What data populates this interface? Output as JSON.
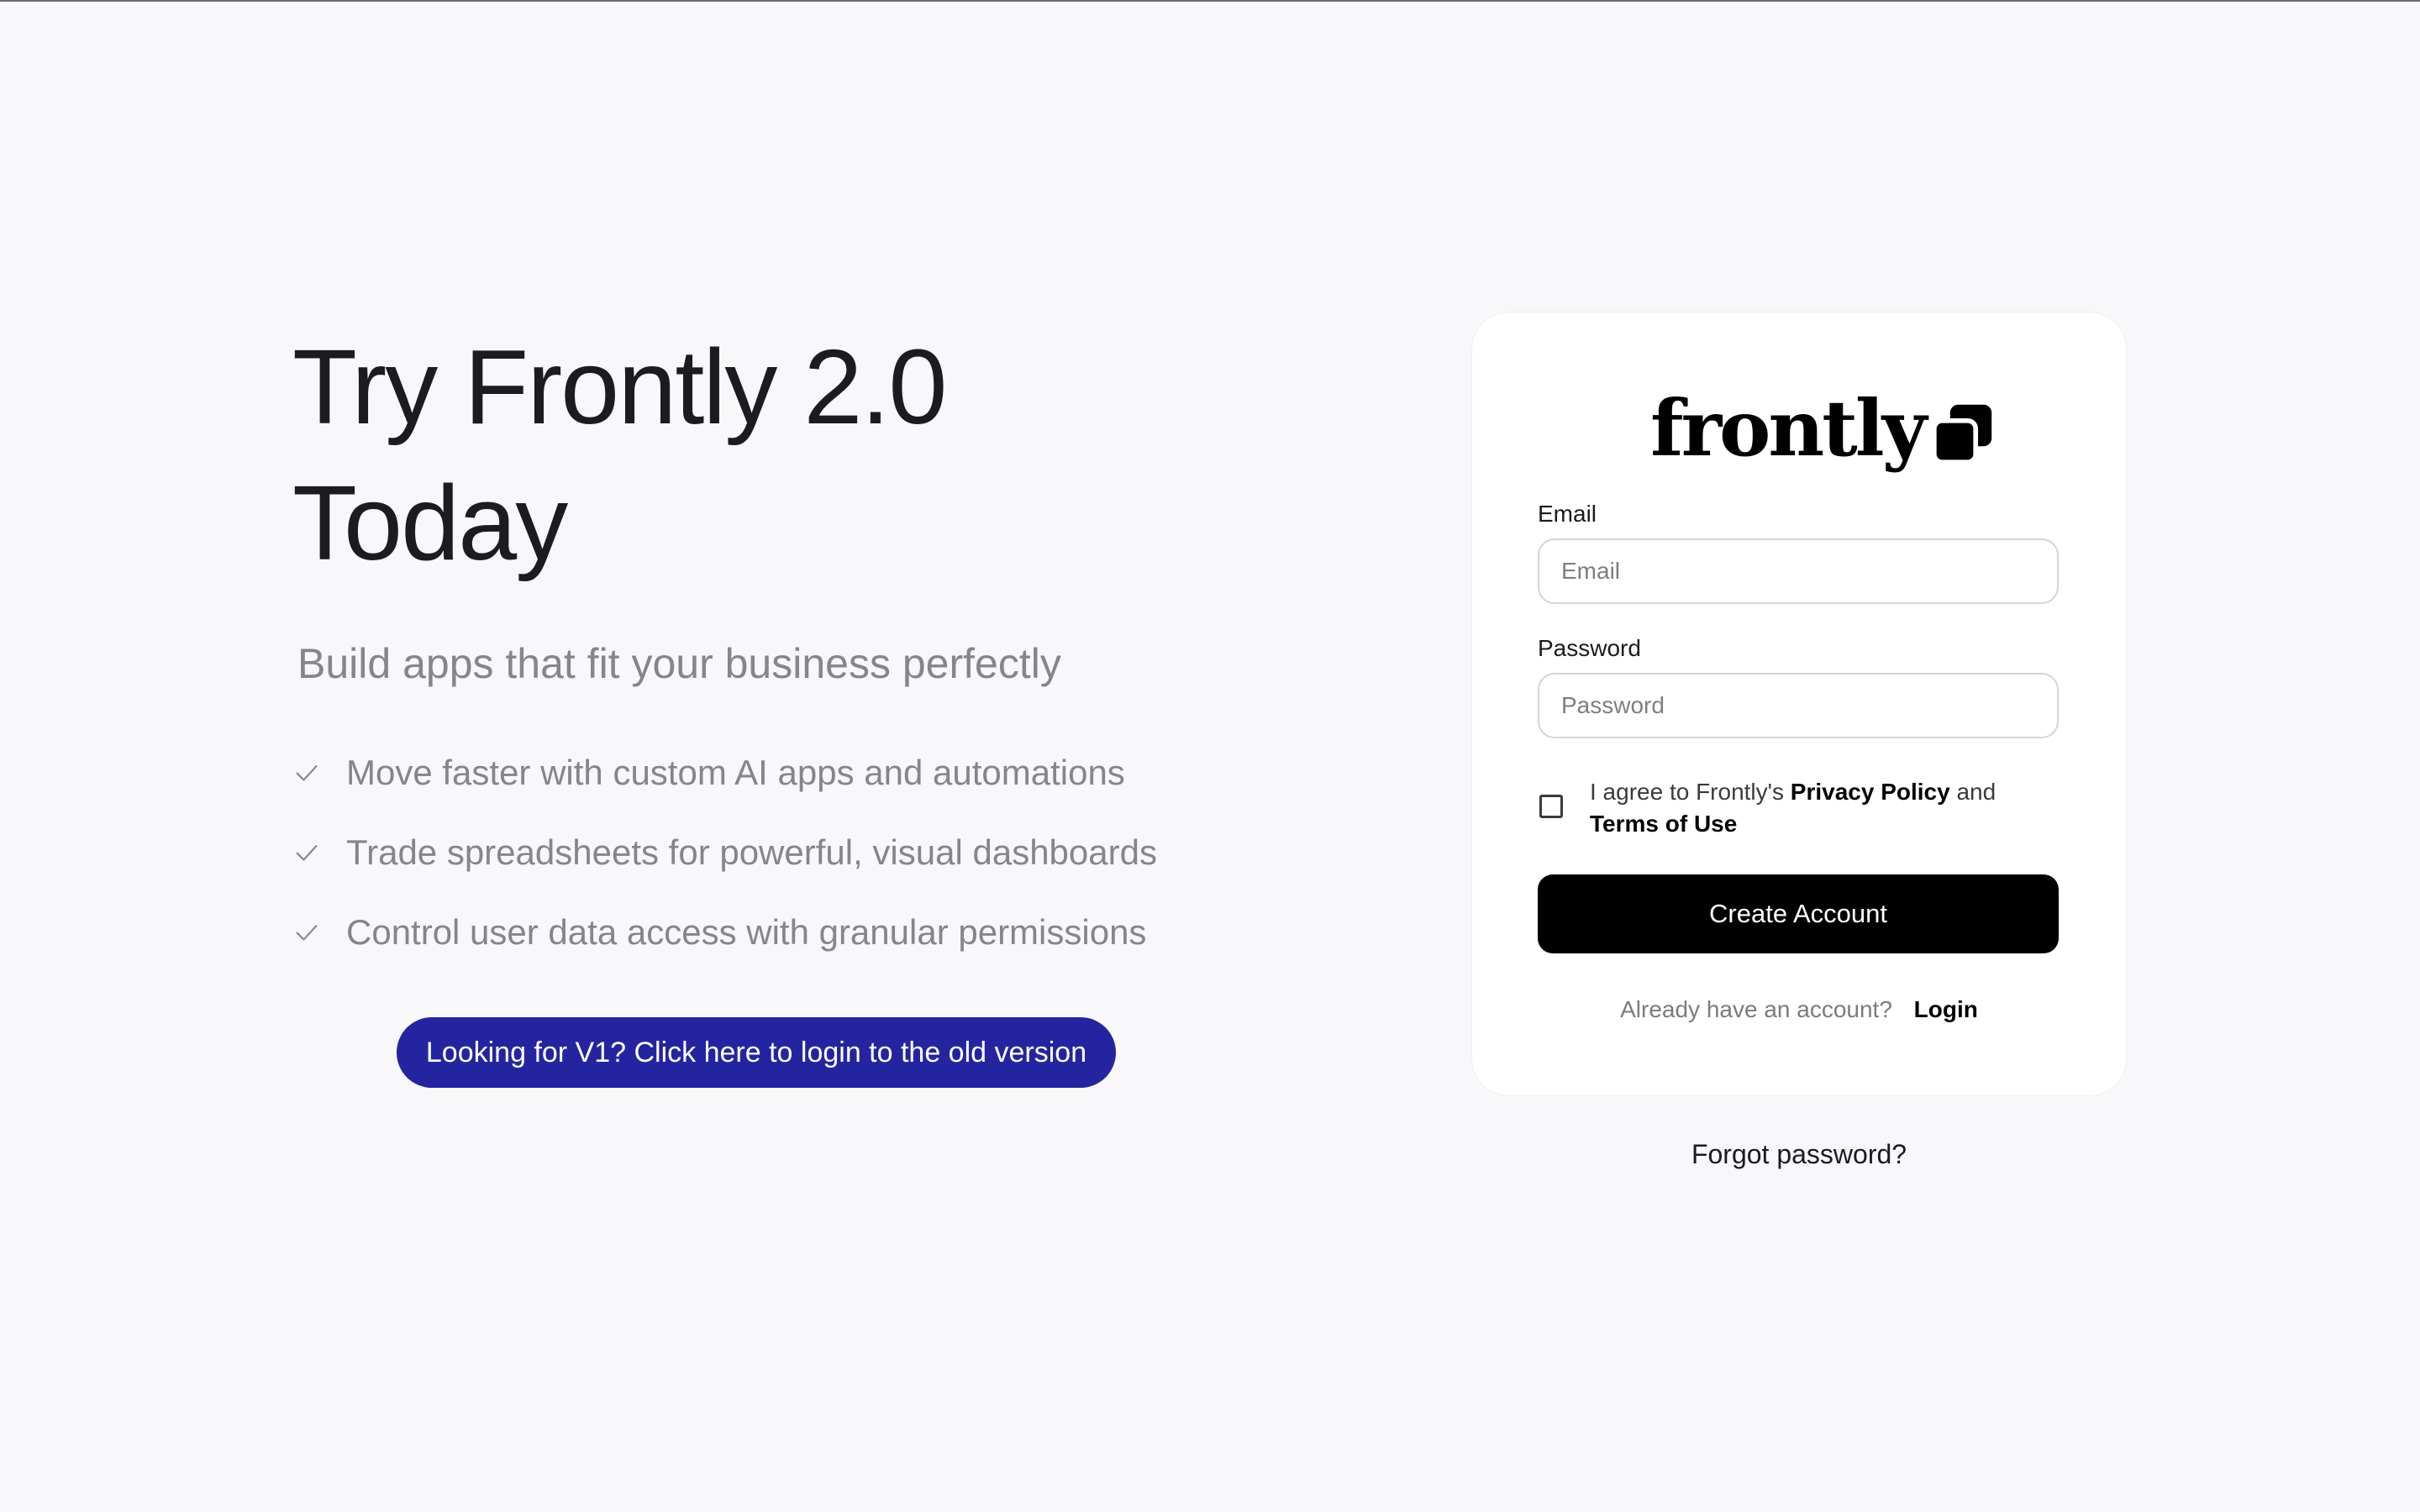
{
  "hero": {
    "title_line1": "Try Frontly 2.0",
    "title_line2": "Today",
    "subtitle": "Build apps that fit your business perfectly",
    "features": [
      {
        "text": "Move faster with custom AI apps and automations",
        "icon": "check-icon"
      },
      {
        "text": "Trade spreadsheets for powerful, visual dashboards",
        "icon": "check-icon"
      },
      {
        "text": "Control user data access with granular permissions",
        "icon": "check-icon"
      }
    ],
    "v1_button_label": "Looking for V1? Click here to login to the old version",
    "v1_button_color": "#2524a0"
  },
  "card": {
    "logo_text": "frontly",
    "logo_icon": "stacked-squares-icon",
    "email": {
      "label": "Email",
      "placeholder": "Email",
      "value": ""
    },
    "password": {
      "label": "Password",
      "placeholder": "Password",
      "value": ""
    },
    "agree": {
      "prefix": "I agree to Frontly's ",
      "privacy_link": "Privacy Policy",
      "middle": " and",
      "terms_link": "Terms of Use",
      "checked": false
    },
    "create_button_label": "Create Account",
    "login_prompt": "Already have an account?",
    "login_link": "Login"
  },
  "forgot_password": "Forgot password?"
}
